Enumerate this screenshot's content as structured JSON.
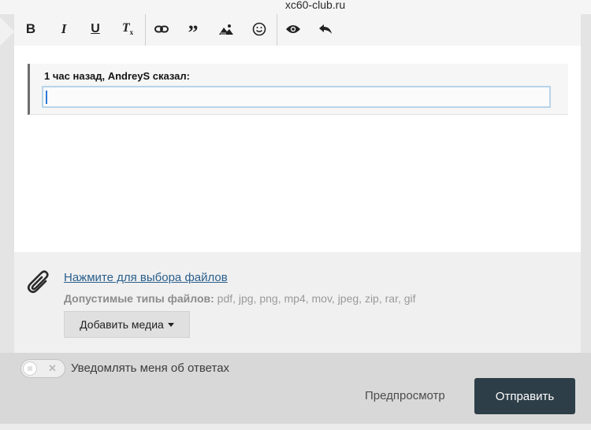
{
  "browser": {
    "url": "xc60-club.ru"
  },
  "toolbar": {
    "buttons": [
      {
        "name": "bold",
        "glyph": "B"
      },
      {
        "name": "italic",
        "glyph": "I"
      },
      {
        "name": "underline",
        "glyph": "U"
      },
      {
        "name": "clear-format",
        "glyph": "T"
      },
      {
        "name": "link",
        "glyph": "link"
      },
      {
        "name": "quote",
        "glyph": "quote"
      },
      {
        "name": "image",
        "glyph": "image"
      },
      {
        "name": "emoji",
        "glyph": "smiley"
      },
      {
        "name": "preview",
        "glyph": "eye"
      },
      {
        "name": "undo",
        "glyph": "arrow-back"
      }
    ]
  },
  "quote": {
    "header": "1 час назад, AndreyS сказал:",
    "input_value": ""
  },
  "attachments": {
    "link_label": "Нажмите для выбора файлов",
    "types_label": "Допустимые типы файлов:",
    "types_value": "pdf, jpg, png, mp4, mov, jpeg, zip, rar, gif",
    "media_button": "Добавить медиа"
  },
  "footer": {
    "notify_label": "Уведомлять меня об ответах",
    "notify_on": false,
    "preview_label": "Предпросмотр",
    "submit_label": "Отправить"
  },
  "colors": {
    "submit_bg": "#2d3e48",
    "link": "#2a5f8c",
    "input_focus": "#b7d4ea"
  }
}
